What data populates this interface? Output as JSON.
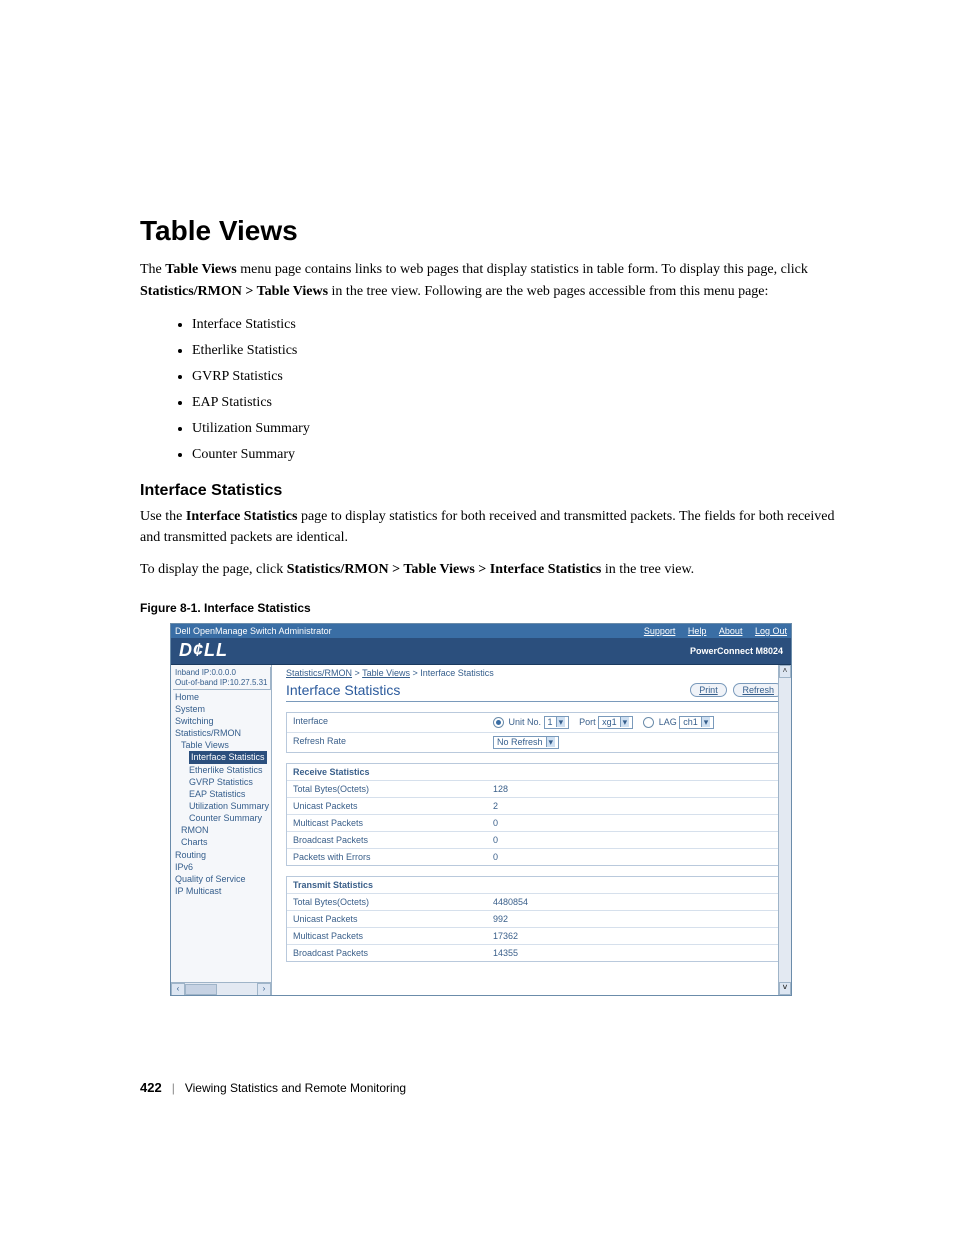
{
  "heading": "Table Views",
  "intro_parts": {
    "pre": "The ",
    "bold1": "Table Views",
    "mid1": " menu page contains links to web pages that display statistics in table form. To display this page, click ",
    "bold2": "Statistics/RMON > Table Views",
    "post": " in the tree view. Following are the web pages accessible from this menu page:"
  },
  "bullets": [
    "Interface Statistics",
    "Etherlike Statistics",
    "GVRP Statistics",
    "EAP Statistics",
    "Utilization Summary",
    "Counter Summary"
  ],
  "sub_heading": "Interface Statistics",
  "sub_para1_parts": {
    "pre": "Use the ",
    "bold": "Interface Statistics",
    "post": " page to display statistics for both received and transmitted packets. The fields for both received and transmitted packets are identical."
  },
  "sub_para2_parts": {
    "pre": "To display the page, click ",
    "bold": "Statistics/RMON > Table Views > Interface Statistics",
    "post": " in the tree view."
  },
  "figure_caption": "Figure 8-1.    Interface Statistics",
  "shot": {
    "topbar_left": "Dell OpenManage Switch Administrator",
    "topbar_links": [
      "Support",
      "Help",
      "About",
      "Log Out"
    ],
    "logo": "D¢LL",
    "model": "PowerConnect M8024",
    "ip1": "Inband IP:0.0.0.0",
    "ip2": "Out-of-band IP:10.27.5.31",
    "tree": {
      "home": "Home",
      "system": "System",
      "switching": "Switching",
      "stats": "Statistics/RMON",
      "table_views": "Table Views",
      "if_stats": "Interface Statistics",
      "ether": "Etherlike Statistics",
      "gvrp": "GVRP Statistics",
      "eap": "EAP Statistics",
      "util": "Utilization Summary",
      "counter": "Counter Summary",
      "rmon": "RMON",
      "charts": "Charts",
      "routing": "Routing",
      "ipv6": "IPv6",
      "qos": "Quality of Service",
      "ipmc": "IP Multicast"
    },
    "breadcrumb": {
      "a": "Statistics/RMON",
      "b": "Table Views",
      "c": "Interface Statistics",
      "sep": " > "
    },
    "page_title": "Interface Statistics",
    "buttons": {
      "print": "Print",
      "refresh": "Refresh"
    },
    "interface_row": {
      "label": "Interface",
      "unit_label": "Unit No.",
      "unit_value": "1",
      "port_label": "Port",
      "port_value": "xg1",
      "lag_label": "LAG",
      "lag_value": "ch1"
    },
    "refresh_row": {
      "label": "Refresh Rate",
      "value": "No Refresh"
    },
    "rx_header": "Receive Statistics",
    "rx_rows": [
      {
        "label": "Total Bytes(Octets)",
        "value": "128"
      },
      {
        "label": "Unicast Packets",
        "value": "2"
      },
      {
        "label": "Multicast Packets",
        "value": "0"
      },
      {
        "label": "Broadcast Packets",
        "value": "0"
      },
      {
        "label": "Packets with Errors",
        "value": "0"
      }
    ],
    "tx_header": "Transmit Statistics",
    "tx_rows": [
      {
        "label": "Total Bytes(Octets)",
        "value": "4480854"
      },
      {
        "label": "Unicast Packets",
        "value": "992"
      },
      {
        "label": "Multicast Packets",
        "value": "17362"
      },
      {
        "label": "Broadcast Packets",
        "value": "14355"
      }
    ]
  },
  "footer": {
    "page_no": "422",
    "sep": "|",
    "chapter": "Viewing Statistics and Remote Monitoring"
  }
}
